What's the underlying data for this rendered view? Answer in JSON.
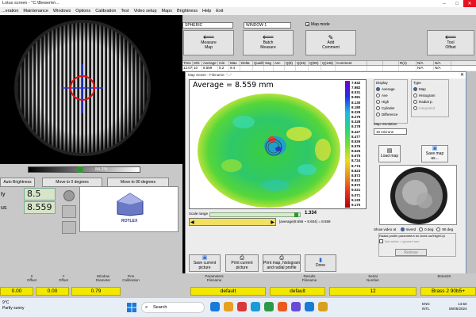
{
  "window": {
    "title": "Lotus screen - \"C:\\Bewerte\\..."
  },
  "menu": [
    "...eration",
    "Maintenance",
    "Windows",
    "Options",
    "Calibration",
    "Test",
    "Video setup",
    "Maps",
    "Brightness",
    "Help",
    "Exit"
  ],
  "left_panel": {
    "progress_label": "84.2%",
    "auto_brightness": "Auto Brightness",
    "move0": "Move to 0 degrees",
    "move90": "Move to 90 degrees",
    "label1": "ty",
    "value1": "8.5",
    "label2": "us",
    "value2": "8.559",
    "logo_text": "ROTLEX"
  },
  "top_controls": {
    "mode_select": "SPHERIC",
    "window_select": "WINDOW 1",
    "map_mode": "Map mode",
    "measure_map": "Measure\nMap",
    "batch_measure": "Batch\nMeasure",
    "add_comment": "Add\nComment",
    "tool_offset": "Tool\nOffset"
  },
  "table": {
    "headers": [
      "Time",
      "S/N",
      "Average",
      "min",
      "Max",
      "Delta",
      "Quality",
      "Sag",
      "Asc",
      "Q(8)",
      "Q(45)",
      "Q(90)",
      "Q(135)",
      "Comment",
      "",
      "",
      "R(4)",
      "N/A",
      "N/A"
    ],
    "row": [
      "12:07",
      "10",
      "8.559",
      "5.2",
      "9.4",
      "",
      "",
      "",
      "",
      "",
      "",
      "",
      "",
      "",
      "",
      "",
      "",
      "N/A",
      "N/A"
    ]
  },
  "map_viewer": {
    "title": "Map viewer - Filename: \"...\"",
    "average_label": "Average = 8.559 mm",
    "display_title": "Display",
    "display_opts": [
      "Average",
      "Ave",
      "High",
      "Cylinder",
      "Difference"
    ],
    "type_title": "Type",
    "type_opts": [
      "Map",
      "Histogram",
      "Radial p.",
      "Integrated"
    ],
    "map_resolution": "Map resolution",
    "resolution_value": "10 microns",
    "load_map": "Load map",
    "save_map": "Save map as...",
    "scale_range_label": "Scale range",
    "scale_range_value": "1.334",
    "range_text": "[average(8.556 ~ 8.604) = 8.559",
    "show_video": "Show video at",
    "video_opts": [
      "Inverd",
      "0 deg",
      "90 deg"
    ],
    "radial_title": "Radial profile parameters for Ave/Low/High/Cyl",
    "radial_check": "Not active = ignored mm",
    "redraw": "Redraw",
    "save_current": "Save current picture",
    "print_current": "Print current picture",
    "print_map": "Print map, histogram\nand radial profile",
    "done": "Done",
    "scale_values": [
      "7.932",
      "7.982",
      "8.031",
      "8.081",
      "8.130",
      "8.180",
      "8.229",
      "8.279",
      "8.328",
      "8.378",
      "8.427",
      "8.477",
      "8.526",
      "8.576",
      "8.625",
      "8.675",
      "8.724",
      "8.774",
      "8.823",
      "8.873",
      "8.922",
      "8.972",
      "9.021",
      "9.071",
      "9.120",
      "9.170"
    ]
  },
  "bottom": {
    "headers": [
      "X\nOffset",
      "Y\nOffset",
      "Window\nDiameter",
      "Fine\nCalibration",
      "Parameters\nFilename",
      "Results\nFilename",
      "Serial\nNumber",
      "Brass2K"
    ],
    "values": [
      "0.00",
      "0.00",
      "0.79",
      "",
      "default",
      "default",
      "12",
      "Brass 2 90b5+"
    ]
  },
  "taskbar": {
    "weather_temp": "9°C",
    "weather_desc": "Partly sunny",
    "search": "Search",
    "lang1": "ENG",
    "lang2": "INTL",
    "time": "14:50",
    "date": "06/05/2024"
  },
  "colors": {
    "panel": "#c8c8c8",
    "accent": "#f2e800",
    "titlebar": "#ffffff"
  }
}
